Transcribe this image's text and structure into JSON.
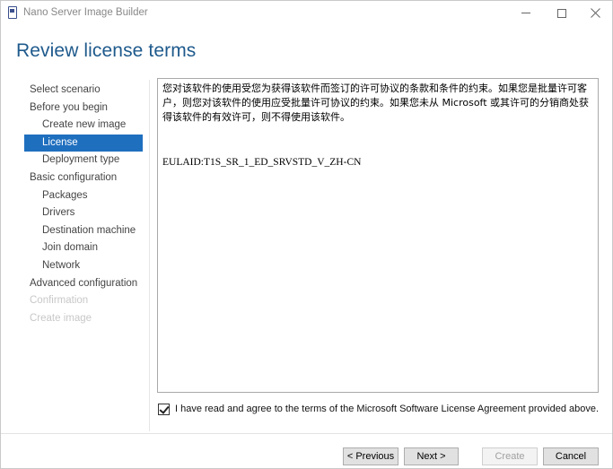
{
  "window": {
    "title": "Nano Server Image Builder"
  },
  "header": {
    "title": "Review license terms"
  },
  "nav": {
    "items": [
      {
        "label": "Select scenario",
        "level": 0,
        "state": "normal"
      },
      {
        "label": "Before you begin",
        "level": 0,
        "state": "normal"
      },
      {
        "label": "Create new image",
        "level": 1,
        "state": "normal"
      },
      {
        "label": "License",
        "level": 1,
        "state": "selected"
      },
      {
        "label": "Deployment type",
        "level": 1,
        "state": "normal"
      },
      {
        "label": "Basic configuration",
        "level": 0,
        "state": "normal"
      },
      {
        "label": "Packages",
        "level": 1,
        "state": "normal"
      },
      {
        "label": "Drivers",
        "level": 1,
        "state": "normal"
      },
      {
        "label": "Destination machine",
        "level": 1,
        "state": "normal"
      },
      {
        "label": "Join domain",
        "level": 1,
        "state": "normal"
      },
      {
        "label": "Network",
        "level": 1,
        "state": "normal"
      },
      {
        "label": "Advanced configuration",
        "level": 0,
        "state": "normal"
      },
      {
        "label": "Confirmation",
        "level": 0,
        "state": "disabled"
      },
      {
        "label": "Create image",
        "level": 0,
        "state": "disabled"
      }
    ]
  },
  "license": {
    "text": "您对该软件的使用受您为获得该软件而签订的许可协议的条款和条件的约束。如果您是批量许可客户，则您对该软件的使用应受批量许可协议的约束。如果您未从 Microsoft 或其许可的分销商处获得该软件的有效许可，则不得使用该软件。",
    "eula_id": "EULAID:T1S_SR_1_ED_SRVSTD_V_ZH-CN"
  },
  "agree": {
    "checked": true,
    "label": "I have read and agree to the terms of the Microsoft Software License Agreement provided above."
  },
  "buttons": {
    "previous": "< Previous",
    "next": "Next >",
    "create": "Create",
    "cancel": "Cancel"
  }
}
